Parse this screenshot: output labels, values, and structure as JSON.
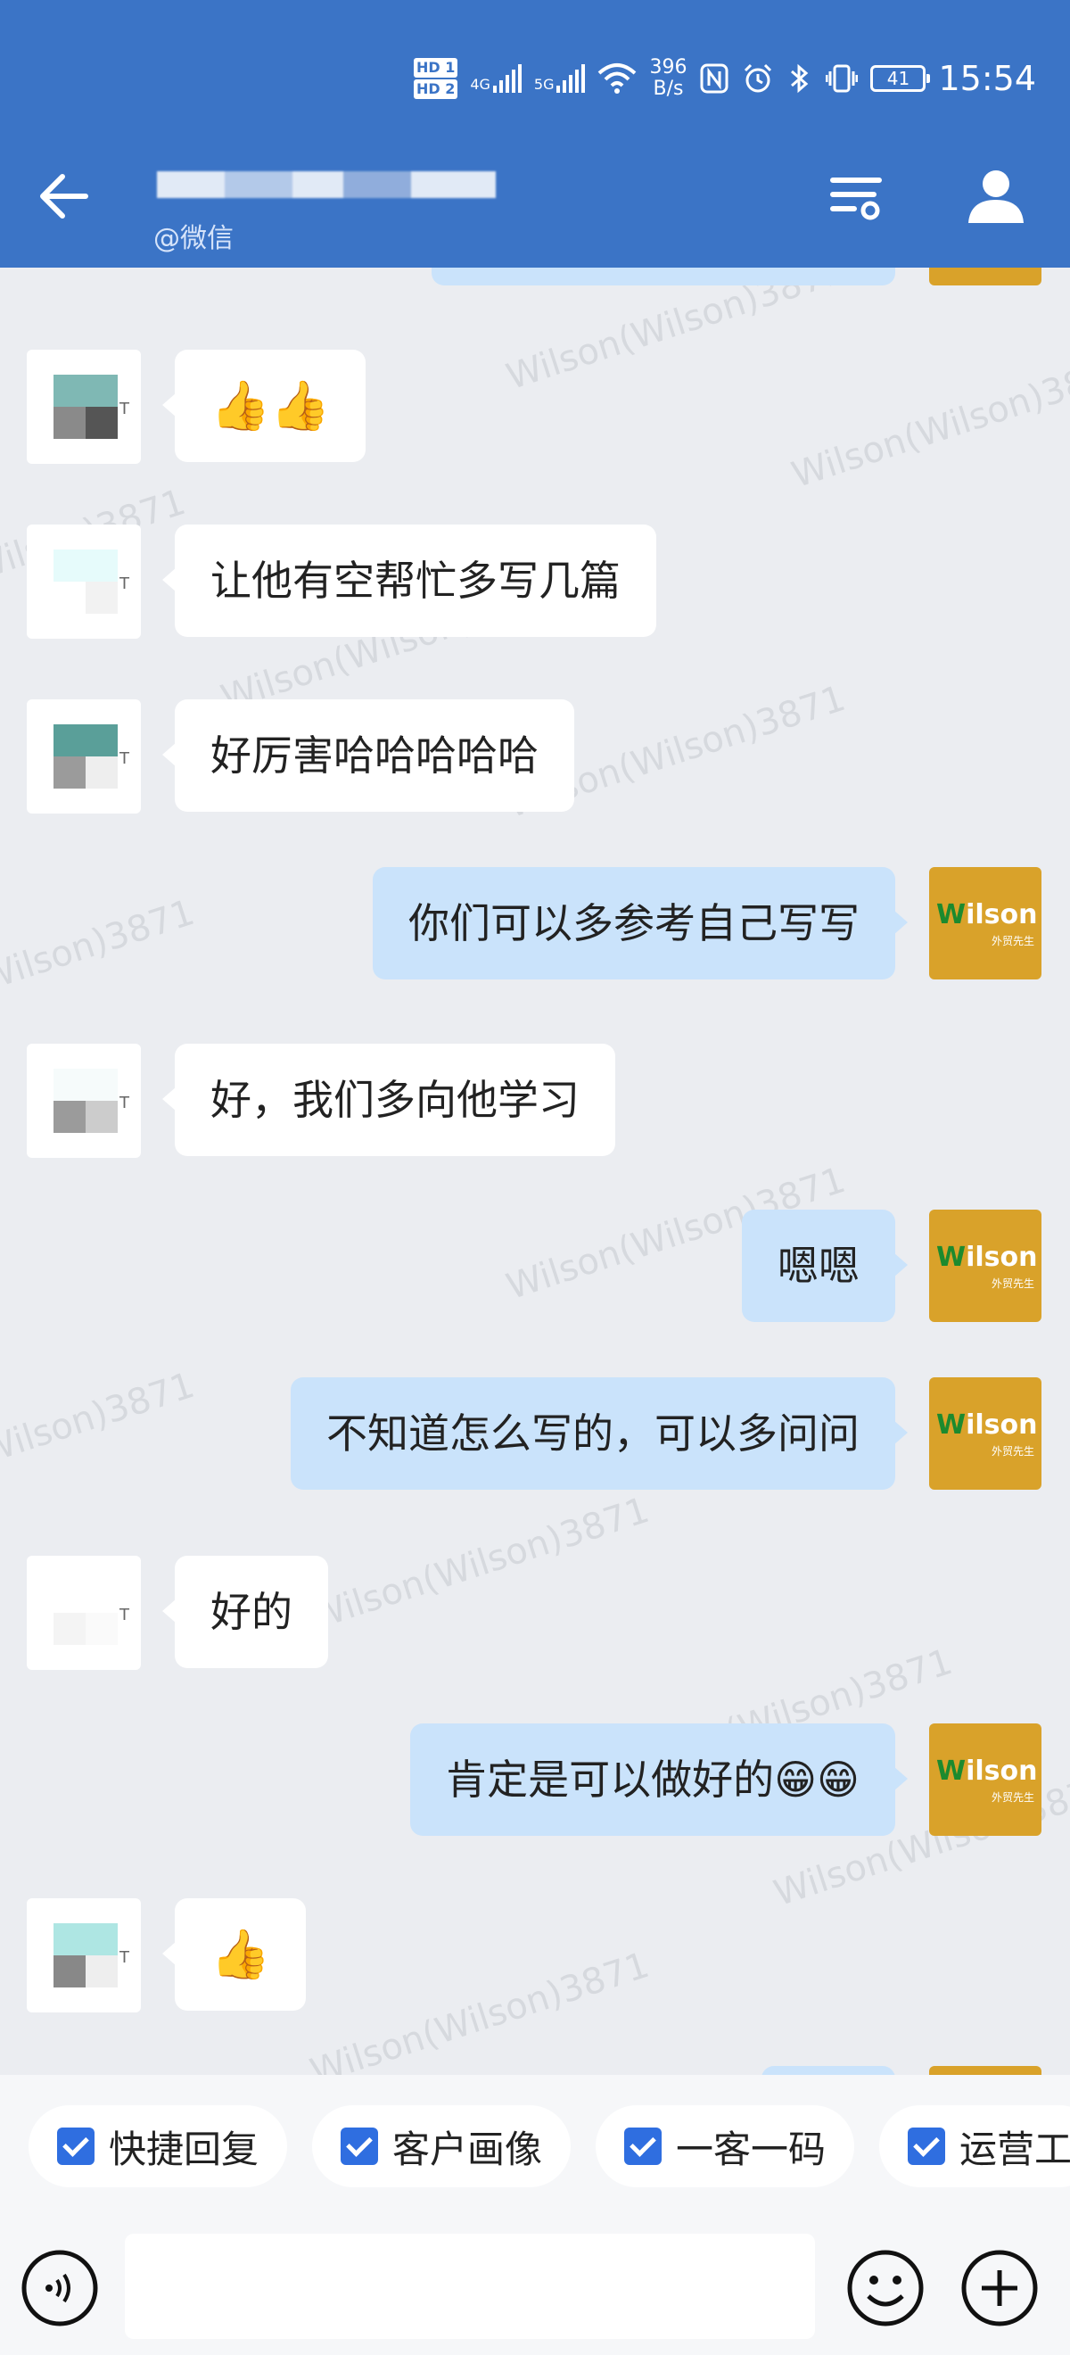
{
  "colors": {
    "header": "#3b74c6",
    "bubble_out": "#cae3fb",
    "bubble_in": "#ffffff",
    "background": "#ebedf1",
    "accent": "#2f6ee0"
  },
  "status_bar": {
    "hd1": "HD 1",
    "hd2": "HD 2",
    "net1": "4G",
    "net2": "5G",
    "speed_value": "396",
    "speed_unit": "B/s",
    "battery": "41",
    "time": "15:54",
    "icons": [
      "wifi-icon",
      "nfc-icon",
      "alarm-icon",
      "bluetooth-icon",
      "vibrate-icon",
      "battery-icon"
    ]
  },
  "header": {
    "subtitle": "@微信"
  },
  "watermark": "Wilson(Wilson)3871",
  "messages": [
    {
      "side": "in",
      "text": "👍👍"
    },
    {
      "side": "in",
      "text": "让他有空帮忙多写几篇"
    },
    {
      "side": "in",
      "text": "好厉害哈哈哈哈哈"
    },
    {
      "side": "out",
      "text": "你们可以多参考自己写写"
    },
    {
      "side": "in",
      "text": "好，我们多向他学习"
    },
    {
      "side": "out",
      "text": "嗯嗯"
    },
    {
      "side": "out",
      "text": "不知道怎么写的，可以多问问"
    },
    {
      "side": "in",
      "text": "好的"
    },
    {
      "side": "out",
      "text": "肯定是可以做好的😁😁"
    },
    {
      "side": "in",
      "text": "👍"
    }
  ],
  "avatar_right": {
    "brand": "Wilson",
    "brand_initial": "W",
    "brand_rest": "ilson",
    "tag": "外贸先生"
  },
  "avatar_left_letter": "T",
  "quick_actions": [
    {
      "label": "快捷回复"
    },
    {
      "label": "客户画像"
    },
    {
      "label": "一客一码"
    },
    {
      "label": "运营工"
    }
  ]
}
